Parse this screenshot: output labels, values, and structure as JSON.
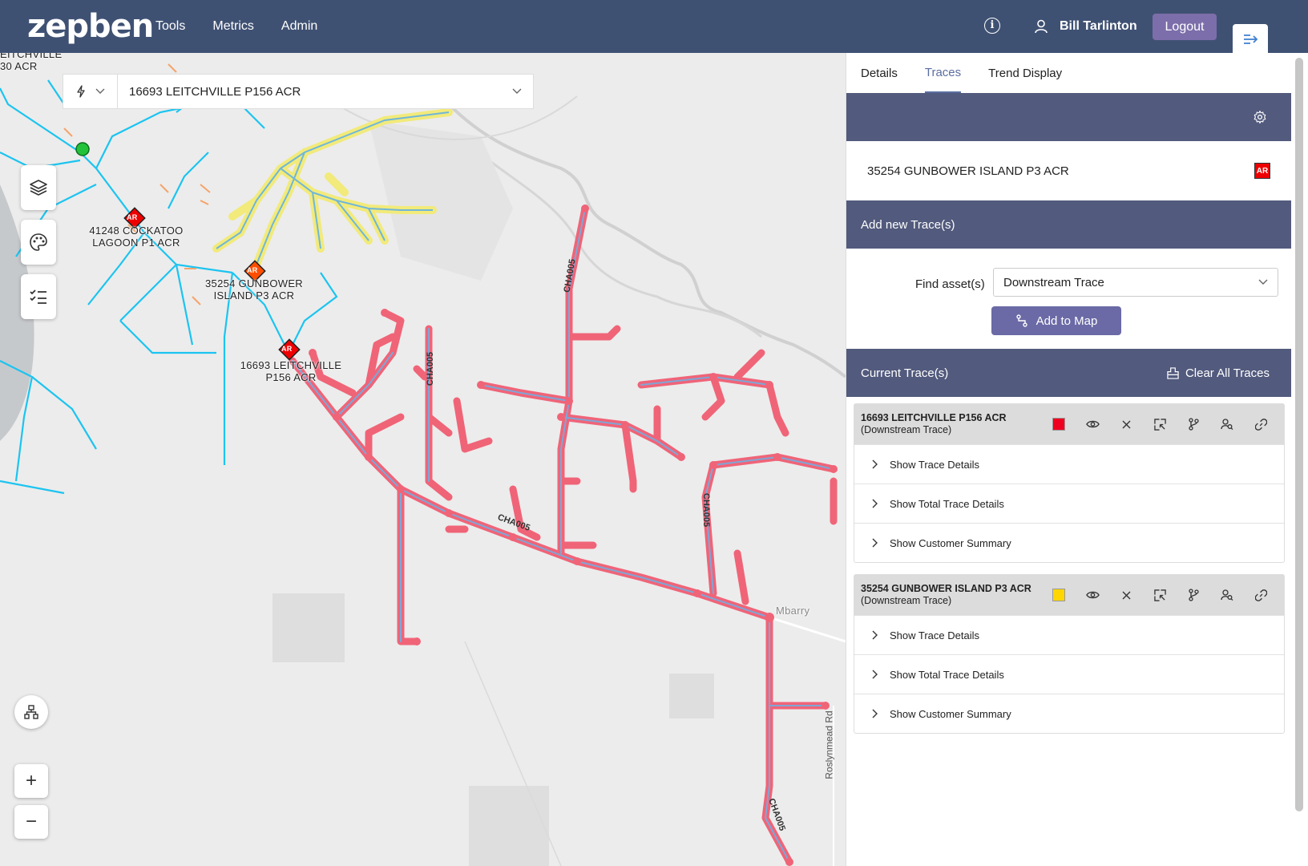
{
  "header": {
    "logo": "zepben",
    "nav": [
      "Tools",
      "Metrics",
      "Admin"
    ],
    "user_name": "Bill Tarlinton",
    "logout_label": "Logout"
  },
  "map": {
    "search": {
      "value": "16693 LEITCHVILLE P156 ACR"
    },
    "labels": {
      "top_left_line1": "EITCHVILLE",
      "top_left_line2": "30 ACR",
      "cockatoo_line1": "41248 COCKATOO",
      "cockatoo_line2": "LAGOON P1 ACR",
      "gunbower_line1": "35254 GUNBOWER",
      "gunbower_line2": "ISLAND P3 ACR",
      "leitchville_line1": "16693 LEITCHVILLE",
      "leitchville_line2": "P156 ACR",
      "ar_badge": "AR",
      "town": "Mbarry",
      "road": "Roslynmead Rd",
      "feeder_code": "CHA005"
    },
    "colors": {
      "background": "#ececec",
      "network_line": "#1cc4f0",
      "trace_red": "#f06478",
      "trace_yellow": "#f2ea7a",
      "trace_center": "#7fa6d6"
    }
  },
  "panel": {
    "tabs": [
      "Details",
      "Traces",
      "Trend Display"
    ],
    "active_tab": "Traces",
    "selected_feeder": "35254 GUNBOWER ISLAND P3 ACR",
    "add_trace_title": "Add new Trace(s)",
    "find_label": "Find asset(s)",
    "find_value": "Downstream Trace",
    "add_to_map_label": "Add to Map",
    "current_traces_title": "Current Trace(s)",
    "clear_all_label": "Clear All Traces",
    "traces": [
      {
        "name": "16693 LEITCHVILLE P156 ACR",
        "type": "(Downstream Trace)",
        "color": "#f00020",
        "rows": [
          "Show Trace Details",
          "Show Total Trace Details",
          "Show Customer Summary"
        ]
      },
      {
        "name": "35254 GUNBOWER ISLAND P3 ACR",
        "type": "(Downstream Trace)",
        "color": "#ffd600",
        "rows": [
          "Show Trace Details",
          "Show Total Trace Details",
          "Show Customer Summary"
        ]
      }
    ]
  }
}
